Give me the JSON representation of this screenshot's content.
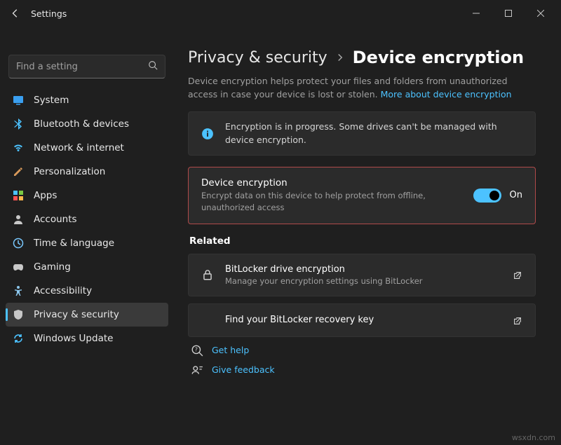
{
  "watermark": "wsxdn.com",
  "titlebar": {
    "title": "Settings"
  },
  "search": {
    "placeholder": "Find a setting"
  },
  "sidebar": {
    "items": [
      {
        "label": "System",
        "icon": "system",
        "selected": false
      },
      {
        "label": "Bluetooth & devices",
        "icon": "bluetooth",
        "selected": false
      },
      {
        "label": "Network & internet",
        "icon": "wifi",
        "selected": false
      },
      {
        "label": "Personalization",
        "icon": "personalize",
        "selected": false
      },
      {
        "label": "Apps",
        "icon": "apps",
        "selected": false
      },
      {
        "label": "Accounts",
        "icon": "accounts",
        "selected": false
      },
      {
        "label": "Time & language",
        "icon": "time",
        "selected": false
      },
      {
        "label": "Gaming",
        "icon": "gaming",
        "selected": false
      },
      {
        "label": "Accessibility",
        "icon": "accessibility",
        "selected": false
      },
      {
        "label": "Privacy & security",
        "icon": "privacy",
        "selected": true
      },
      {
        "label": "Windows Update",
        "icon": "update",
        "selected": false
      }
    ]
  },
  "breadcrumb": {
    "parent": "Privacy & security",
    "current": "Device encryption"
  },
  "description": {
    "text": "Device encryption helps protect your files and folders from unauthorized access in case your device is lost or stolen.",
    "link": "More about device encryption"
  },
  "info_banner": {
    "text": "Encryption is in progress. Some drives can't be managed with device encryption."
  },
  "toggle_card": {
    "title": "Device encryption",
    "sub": "Encrypt data on this device to help protect from offline, unauthorized access",
    "state_label": "On",
    "on": true
  },
  "related": {
    "heading": "Related",
    "items": [
      {
        "title": "BitLocker drive encryption",
        "sub": "Manage your encryption settings using BitLocker",
        "icon": "lock",
        "trail": "open"
      },
      {
        "title": "Find your BitLocker recovery key",
        "sub": "",
        "icon": "",
        "trail": "open"
      }
    ]
  },
  "footer_links": [
    {
      "label": "Get help",
      "icon": "help"
    },
    {
      "label": "Give feedback",
      "icon": "feedback"
    }
  ]
}
